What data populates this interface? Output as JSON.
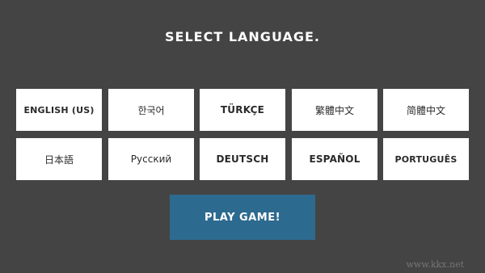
{
  "title": "SELECT LANGUAGE.",
  "languages": [
    {
      "label": "ENGLISH (US)",
      "style": "bold narrow"
    },
    {
      "label": "한국어",
      "style": ""
    },
    {
      "label": "TÜRKÇE",
      "style": "bold"
    },
    {
      "label": "繁體中文",
      "style": ""
    },
    {
      "label": "简體中文",
      "style": ""
    },
    {
      "label": "日本語",
      "style": ""
    },
    {
      "label": "Русский",
      "style": ""
    },
    {
      "label": "DEUTSCH",
      "style": "bold"
    },
    {
      "label": "ESPAÑOL",
      "style": "bold"
    },
    {
      "label": "PORTUGUÊS",
      "style": "bold narrow"
    }
  ],
  "play_button": {
    "label": "PLAY GAME!"
  },
  "watermark": "www.kkx.net",
  "colors": {
    "background": "#444444",
    "tile": "#ffffff",
    "play_button": "#2d6a8f",
    "text_light": "#ffffff"
  }
}
